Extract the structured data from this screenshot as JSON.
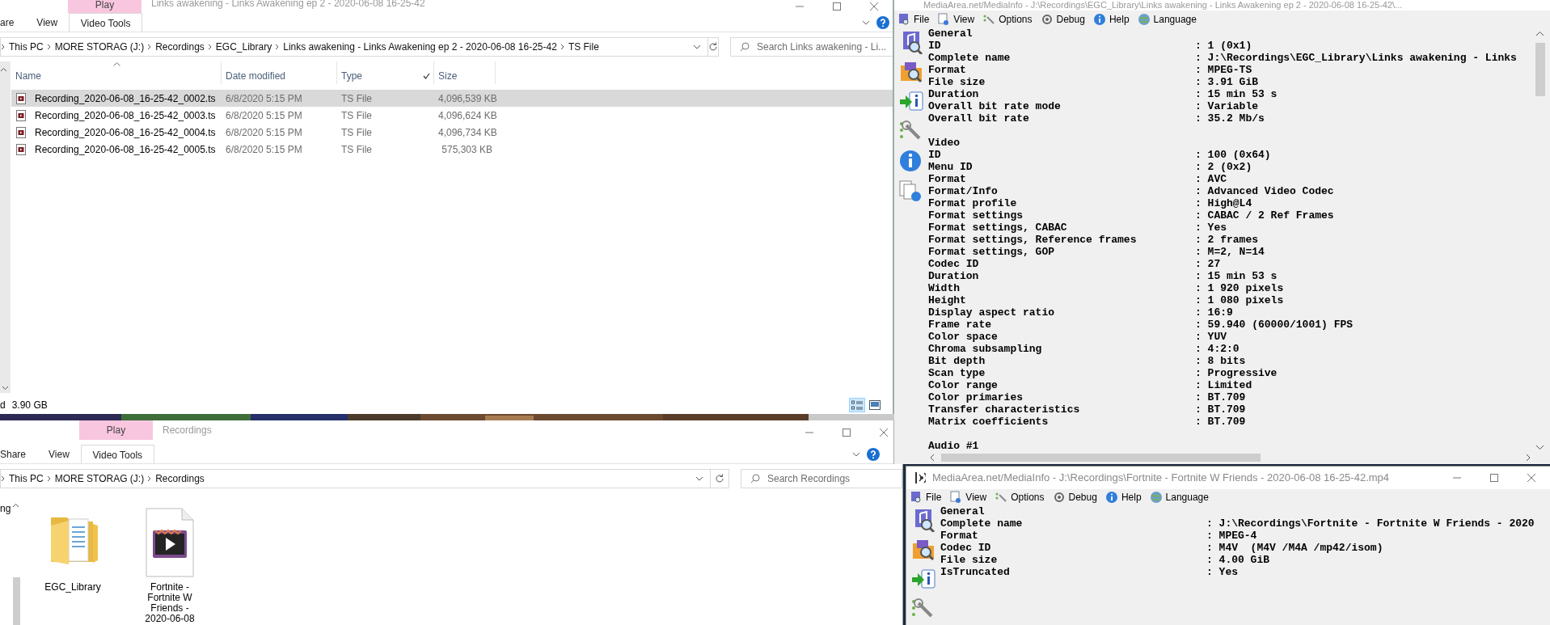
{
  "explorer_top": {
    "title": "Links awakening - Links Awakening ep 2 - 2020-06-08 16-25-42",
    "context_tab": "Play",
    "ribbon_tabs": [
      {
        "label": "are",
        "selected": false
      },
      {
        "label": "View",
        "selected": false
      },
      {
        "label": "Video Tools",
        "selected": true
      }
    ],
    "address": [
      "This PC",
      "MORE STORAG (J:)",
      "Recordings",
      "EGC_Library",
      "Links awakening - Links Awakening ep 2 - 2020-06-08 16-25-42",
      "TS File"
    ],
    "search": {
      "placeholder": "Search Links awakening - Li..."
    },
    "columns": [
      {
        "label": "Name",
        "sorted": true
      },
      {
        "label": "Date modified",
        "sorted": false
      },
      {
        "label": "Type",
        "sorted": false
      },
      {
        "label": "Size",
        "sorted": false
      }
    ],
    "rows": [
      {
        "name": "Recording_2020-06-08_16-25-42_0002.ts",
        "date": "6/8/2020 5:15 PM",
        "type": "TS File",
        "size": "4,096,539 KB",
        "selected": true
      },
      {
        "name": "Recording_2020-06-08_16-25-42_0003.ts",
        "date": "6/8/2020 5:15 PM",
        "type": "TS File",
        "size": "4,096,624 KB",
        "selected": false
      },
      {
        "name": "Recording_2020-06-08_16-25-42_0004.ts",
        "date": "6/8/2020 5:15 PM",
        "type": "TS File",
        "size": "4,096,734 KB",
        "selected": false
      },
      {
        "name": "Recording_2020-06-08_16-25-42_0005.ts",
        "date": "6/8/2020 5:15 PM",
        "type": "TS File",
        "size": "575,303 KB",
        "selected": false
      }
    ],
    "status_items": [
      "d",
      "3.90 GB"
    ],
    "view_buttons": [
      {
        "kind": "details",
        "selected": true
      },
      {
        "kind": "large_icons",
        "selected": false
      }
    ]
  },
  "explorer_bottom": {
    "title": "Recordings",
    "context_tab": "Play",
    "ribbon_tabs": [
      {
        "label": "Share",
        "selected": false
      },
      {
        "label": "View",
        "selected": false
      },
      {
        "label": "Video Tools",
        "selected": true
      }
    ],
    "address": [
      "This PC",
      "MORE STORAG (J:)",
      "Recordings"
    ],
    "search": {
      "placeholder": "Search Recordings"
    },
    "nav_text": "ng",
    "items": [
      {
        "label": "EGC_Library",
        "kind": "folder"
      },
      {
        "label": "Fortnite - Fortnite W Friends - 2020-06-08",
        "kind": "video"
      }
    ]
  },
  "mediainfo_top": {
    "title": "MediaArea.net/MediaInfo - J:\\Recordings\\EGC_Library\\Links awakening - Links Awakening ep 2 - 2020-06-08 16-25-42\\...",
    "menu": [
      "File",
      "View",
      "Options",
      "Debug",
      "Help",
      "Language"
    ],
    "lines": [
      {
        "kind": "section",
        "text": "General"
      },
      {
        "kind": "field",
        "label": "ID",
        "value": ": 1 (0x1)"
      },
      {
        "kind": "field",
        "label": "Complete name",
        "value": ": J:\\Recordings\\EGC_Library\\Links awakening - Links"
      },
      {
        "kind": "field",
        "label": "Format",
        "value": ": MPEG-TS"
      },
      {
        "kind": "field",
        "label": "File size",
        "value": ": 3.91 GiB"
      },
      {
        "kind": "field",
        "label": "Duration",
        "value": ": 15 min 53 s"
      },
      {
        "kind": "field",
        "label": "Overall bit rate mode",
        "value": ": Variable"
      },
      {
        "kind": "field",
        "label": "Overall bit rate",
        "value": ": 35.2 Mb/s"
      },
      {
        "kind": "blank"
      },
      {
        "kind": "section",
        "text": "Video"
      },
      {
        "kind": "field",
        "label": "ID",
        "value": ": 100 (0x64)"
      },
      {
        "kind": "field",
        "label": "Menu ID",
        "value": ": 2 (0x2)"
      },
      {
        "kind": "field",
        "label": "Format",
        "value": ": AVC"
      },
      {
        "kind": "field",
        "label": "Format/Info",
        "value": ": Advanced Video Codec"
      },
      {
        "kind": "field",
        "label": "Format profile",
        "value": ": High@L4"
      },
      {
        "kind": "field",
        "label": "Format settings",
        "value": ": CABAC / 2 Ref Frames"
      },
      {
        "kind": "field",
        "label": "Format settings, CABAC",
        "value": ": Yes"
      },
      {
        "kind": "field",
        "label": "Format settings, Reference frames",
        "value": ": 2 frames"
      },
      {
        "kind": "field",
        "label": "Format settings, GOP",
        "value": ": M=2, N=14"
      },
      {
        "kind": "field",
        "label": "Codec ID",
        "value": ": 27"
      },
      {
        "kind": "field",
        "label": "Duration",
        "value": ": 15 min 53 s"
      },
      {
        "kind": "field",
        "label": "Width",
        "value": ": 1 920 pixels"
      },
      {
        "kind": "field",
        "label": "Height",
        "value": ": 1 080 pixels"
      },
      {
        "kind": "field",
        "label": "Display aspect ratio",
        "value": ": 16:9"
      },
      {
        "kind": "field",
        "label": "Frame rate",
        "value": ": 59.940 (60000/1001) FPS"
      },
      {
        "kind": "field",
        "label": "Color space",
        "value": ": YUV"
      },
      {
        "kind": "field",
        "label": "Chroma subsampling",
        "value": ": 4:2:0"
      },
      {
        "kind": "field",
        "label": "Bit depth",
        "value": ": 8 bits"
      },
      {
        "kind": "field",
        "label": "Scan type",
        "value": ": Progressive"
      },
      {
        "kind": "field",
        "label": "Color range",
        "value": ": Limited"
      },
      {
        "kind": "field",
        "label": "Color primaries",
        "value": ": BT.709"
      },
      {
        "kind": "field",
        "label": "Transfer characteristics",
        "value": ": BT.709"
      },
      {
        "kind": "field",
        "label": "Matrix coefficients",
        "value": ": BT.709"
      },
      {
        "kind": "blank"
      },
      {
        "kind": "section",
        "text": "Audio #1"
      }
    ]
  },
  "mediainfo_bottom": {
    "title": "MediaArea.net/MediaInfo - J:\\Recordings\\Fortnite - Fortnite W Friends - 2020-06-08 16-25-42.mp4",
    "menu": [
      "File",
      "View",
      "Options",
      "Debug",
      "Help",
      "Language"
    ],
    "lines": [
      {
        "kind": "section",
        "text": "General"
      },
      {
        "kind": "field",
        "label": "Complete name",
        "value": ": J:\\Recordings\\Fortnite - Fortnite W Friends - 2020"
      },
      {
        "kind": "field",
        "label": "Format",
        "value": ": MPEG-4"
      },
      {
        "kind": "field",
        "label": "Codec ID",
        "value": ": M4V  (M4V /M4A /mp42/isom)"
      },
      {
        "kind": "field",
        "label": "File size",
        "value": ": 4.00 GiB"
      },
      {
        "kind": "field",
        "label": "IsTruncated",
        "value": ": Yes"
      }
    ]
  }
}
